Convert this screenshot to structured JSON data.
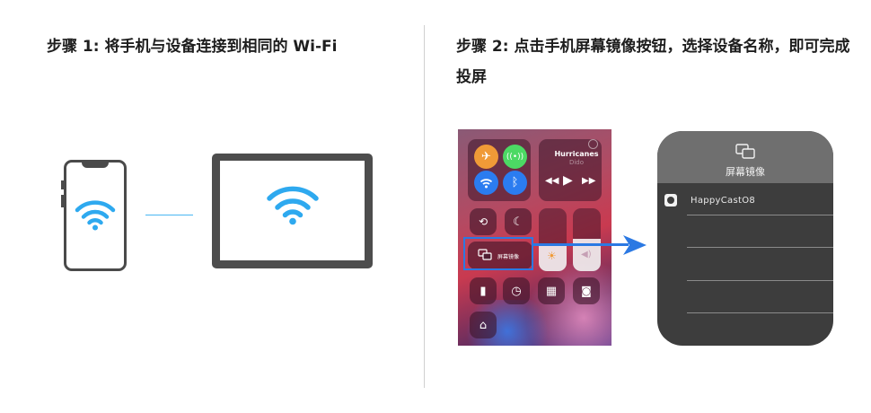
{
  "step1": {
    "title": "步骤 1: 将手机与设备连接到相同的 Wi-Fi"
  },
  "step2": {
    "title": "步骤 2: 点击手机屏幕镜像按钮，选择设备名称，即可完成投屏"
  },
  "control_center": {
    "music_title": "Hurricanes",
    "music_artist": "Dido",
    "mirroring_label": "屏幕镜像"
  },
  "device_panel": {
    "header_label": "屏幕镜像",
    "device_name": "HappyCastO8"
  },
  "colors": {
    "wifi_blue": "#2ea9ef",
    "highlight_blue": "#2b79e3",
    "airplane_orange": "#f09a37",
    "cellular_green": "#4cd964"
  },
  "icons": [
    "wifi-icon",
    "airplane-icon",
    "cellular-icon",
    "bluetooth-icon",
    "rotation-lock-icon",
    "moon-icon",
    "screen-mirroring-icon",
    "brightness-icon",
    "volume-icon",
    "flashlight-icon",
    "timer-icon",
    "calculator-icon",
    "camera-icon",
    "home-icon",
    "apple-icon",
    "arrow-right-icon"
  ]
}
